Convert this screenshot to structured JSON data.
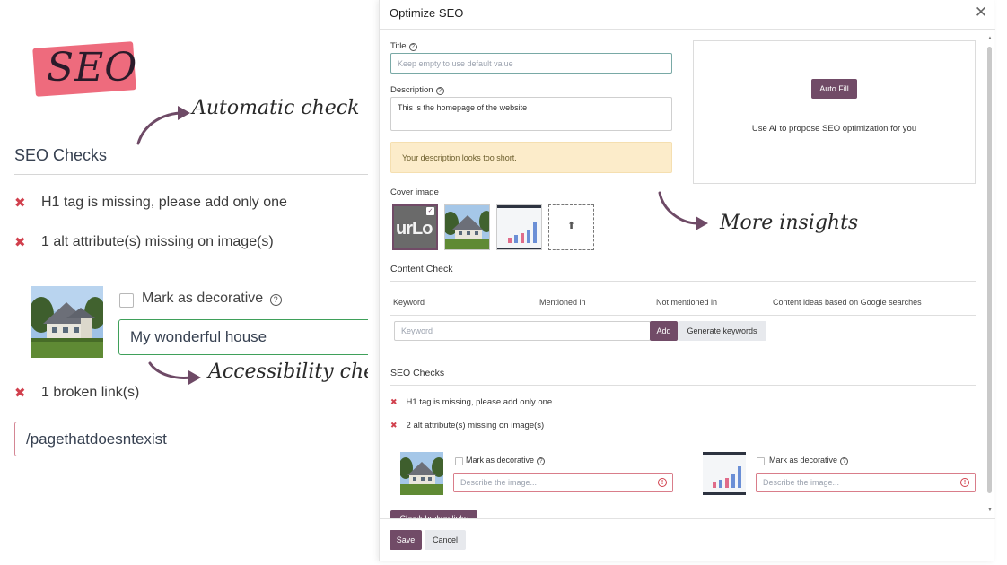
{
  "left": {
    "badge": "SEO",
    "annotation_auto": "Automatic check",
    "annotation_access": "Accessibility checks",
    "heading": "SEO Checks",
    "checks": [
      "H1 tag is missing, please add only one",
      "1 alt attribute(s) missing on image(s)"
    ],
    "mark_decorative": "Mark as decorative",
    "alt_value": "My wonderful house",
    "broken_links": "1 broken link(s)",
    "broken_url": "/pagethatdoesntexist"
  },
  "annotation_insights": "More insights",
  "dialog": {
    "title": "Optimize SEO",
    "close_icon": "close-icon",
    "title_label": "Title",
    "title_placeholder": "Keep empty to use default value",
    "description_label": "Description",
    "description_value": "This is the homepage of the website",
    "warning": "Your description looks too short.",
    "autofill_button": "Auto Fill",
    "ai_text": "Use AI to propose SEO optimization for you",
    "cover_label": "Cover image",
    "cover_logo_text": "urLo",
    "content_check_title": "Content Check",
    "table_headers": [
      "Keyword",
      "Mentioned in",
      "Not mentioned in",
      "Content ideas based on Google searches"
    ],
    "keyword_placeholder": "Keyword",
    "add_button": "Add",
    "generate_button": "Generate keywords",
    "seo_checks_title": "SEO Checks",
    "checks": [
      "H1 tag is missing, please add only one",
      "2 alt attribute(s) missing on image(s)"
    ],
    "mark_decorative": "Mark as decorative",
    "alt_placeholder": "Describe the image...",
    "broken_links_button": "Check broken links",
    "save_button": "Save",
    "cancel_button": "Cancel"
  },
  "colors": {
    "primary": "#714b67",
    "danger": "#d1404d",
    "warning_bg": "#fcecca",
    "badge": "#ee6b7d",
    "success_border": "#3fa05a"
  }
}
